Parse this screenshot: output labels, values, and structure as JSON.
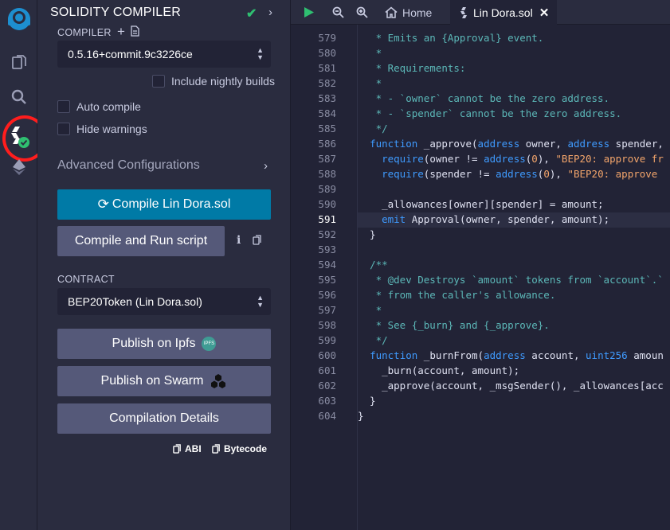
{
  "panel": {
    "title": "SOLIDITY COMPILER",
    "compiler_label": "COMPILER",
    "compiler_version": "0.5.16+commit.9c3226ce",
    "nightly_label": "Include nightly builds",
    "auto_compile_label": "Auto compile",
    "hide_warnings_label": "Hide warnings",
    "advanced_label": "Advanced Configurations",
    "compile_button": "Compile Lin Dora.sol",
    "compile_run_button": "Compile and Run script",
    "contract_label": "CONTRACT",
    "contract_value": "BEP20Token (Lin Dora.sol)",
    "publish_ipfs": "Publish on Ipfs",
    "ipfs_badge": "IPFS",
    "publish_swarm": "Publish on Swarm",
    "compilation_details": "Compilation Details",
    "abi_link": "ABI",
    "bytecode_link": "Bytecode"
  },
  "editor": {
    "tabs": [
      {
        "label": "Home"
      },
      {
        "label": "Lin Dora.sol"
      }
    ],
    "active_line": 591,
    "lines": [
      {
        "n": "579",
        "html": "   <span class=\"c\">* Emits an {Approval} event.</span>"
      },
      {
        "n": "580",
        "html": "   <span class=\"c\">*</span>"
      },
      {
        "n": "581",
        "html": "   <span class=\"c\">* Requirements:</span>"
      },
      {
        "n": "582",
        "html": "   <span class=\"c\">*</span>"
      },
      {
        "n": "583",
        "html": "   <span class=\"c\">* - `owner` cannot be the zero address.</span>"
      },
      {
        "n": "584",
        "html": "   <span class=\"c\">* - `spender` cannot be the zero address.</span>"
      },
      {
        "n": "585",
        "html": "   <span class=\"c\">*/</span>"
      },
      {
        "n": "586",
        "html": "  <span class=\"k\">function</span> _approve(<span class=\"k\">address</span> owner, <span class=\"k\">address</span> spender,"
      },
      {
        "n": "587",
        "html": "    <span class=\"k\">require</span>(owner != <span class=\"k\">address</span>(<span class=\"n\">0</span>), <span class=\"s\">\"BEP20: approve fr</span>"
      },
      {
        "n": "588",
        "html": "    <span class=\"k\">require</span>(spender != <span class=\"k\">address</span>(<span class=\"n\">0</span>), <span class=\"s\">\"BEP20: approve</span>"
      },
      {
        "n": "589",
        "html": ""
      },
      {
        "n": "590",
        "html": "    _allowances[owner][spender] = amount;"
      },
      {
        "n": "591",
        "html": "    <span class=\"k\">emit</span> Approval(owner, spender, amount);"
      },
      {
        "n": "592",
        "html": "  }"
      },
      {
        "n": "593",
        "html": ""
      },
      {
        "n": "594",
        "html": "  <span class=\"c\">/**</span>"
      },
      {
        "n": "595",
        "html": "   <span class=\"c\">* @dev Destroys `amount` tokens from `account`.`</span>"
      },
      {
        "n": "596",
        "html": "   <span class=\"c\">* from the caller's allowance.</span>"
      },
      {
        "n": "597",
        "html": "   <span class=\"c\">*</span>"
      },
      {
        "n": "598",
        "html": "   <span class=\"c\">* See {_burn} and {_approve}.</span>"
      },
      {
        "n": "599",
        "html": "   <span class=\"c\">*/</span>"
      },
      {
        "n": "600",
        "html": "  <span class=\"k\">function</span> _burnFrom(<span class=\"k\">address</span> account, <span class=\"k\">uint256</span> amoun"
      },
      {
        "n": "601",
        "html": "    _burn(account, amount);"
      },
      {
        "n": "602",
        "html": "    _approve(account, _msgSender(), _allowances[acc"
      },
      {
        "n": "603",
        "html": "  }"
      },
      {
        "n": "604",
        "html": "}"
      }
    ]
  },
  "colors": {
    "accent": "#007aa6",
    "success": "#2fbf71",
    "highlight_ring": "#ff1d1d"
  }
}
